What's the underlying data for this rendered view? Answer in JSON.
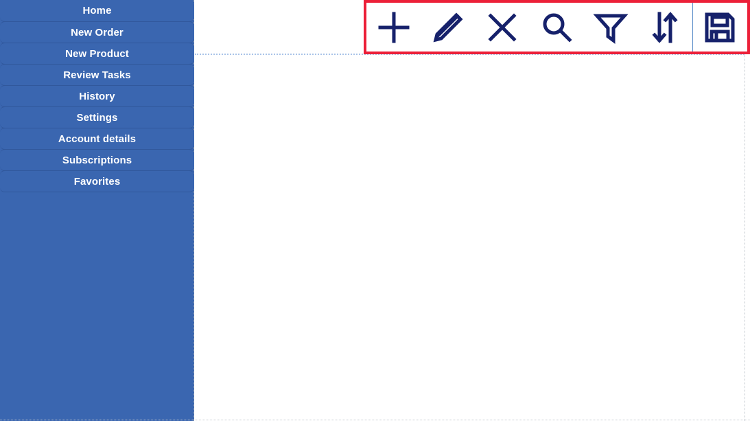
{
  "sidebar": {
    "name": "main-navigation",
    "background_color": "#3a66b0",
    "text_color": "#ffffff",
    "items": [
      {
        "label": "Home"
      },
      {
        "label": "New Order"
      },
      {
        "label": "New Product"
      },
      {
        "label": "Review Tasks"
      },
      {
        "label": "History"
      },
      {
        "label": "Settings"
      },
      {
        "label": "Account details"
      },
      {
        "label": "Subscriptions"
      },
      {
        "label": "Favorites"
      }
    ]
  },
  "toolbar": {
    "name": "action-toolbar",
    "highlight_color": "#ec1f38",
    "icon_color": "#16216b",
    "separator_color": "#5b8ec9",
    "buttons": [
      {
        "icon": "plus-icon",
        "label": "Add"
      },
      {
        "icon": "pencil-icon",
        "label": "Edit"
      },
      {
        "icon": "close-icon",
        "label": "Delete"
      },
      {
        "icon": "search-icon",
        "label": "Search"
      },
      {
        "icon": "filter-icon",
        "label": "Filter"
      },
      {
        "icon": "sort-icon",
        "label": "Sort"
      },
      {
        "icon": "save-icon",
        "label": "Save"
      }
    ]
  },
  "main": {
    "name": "content-area",
    "background_color": "#ffffff",
    "content": ""
  }
}
